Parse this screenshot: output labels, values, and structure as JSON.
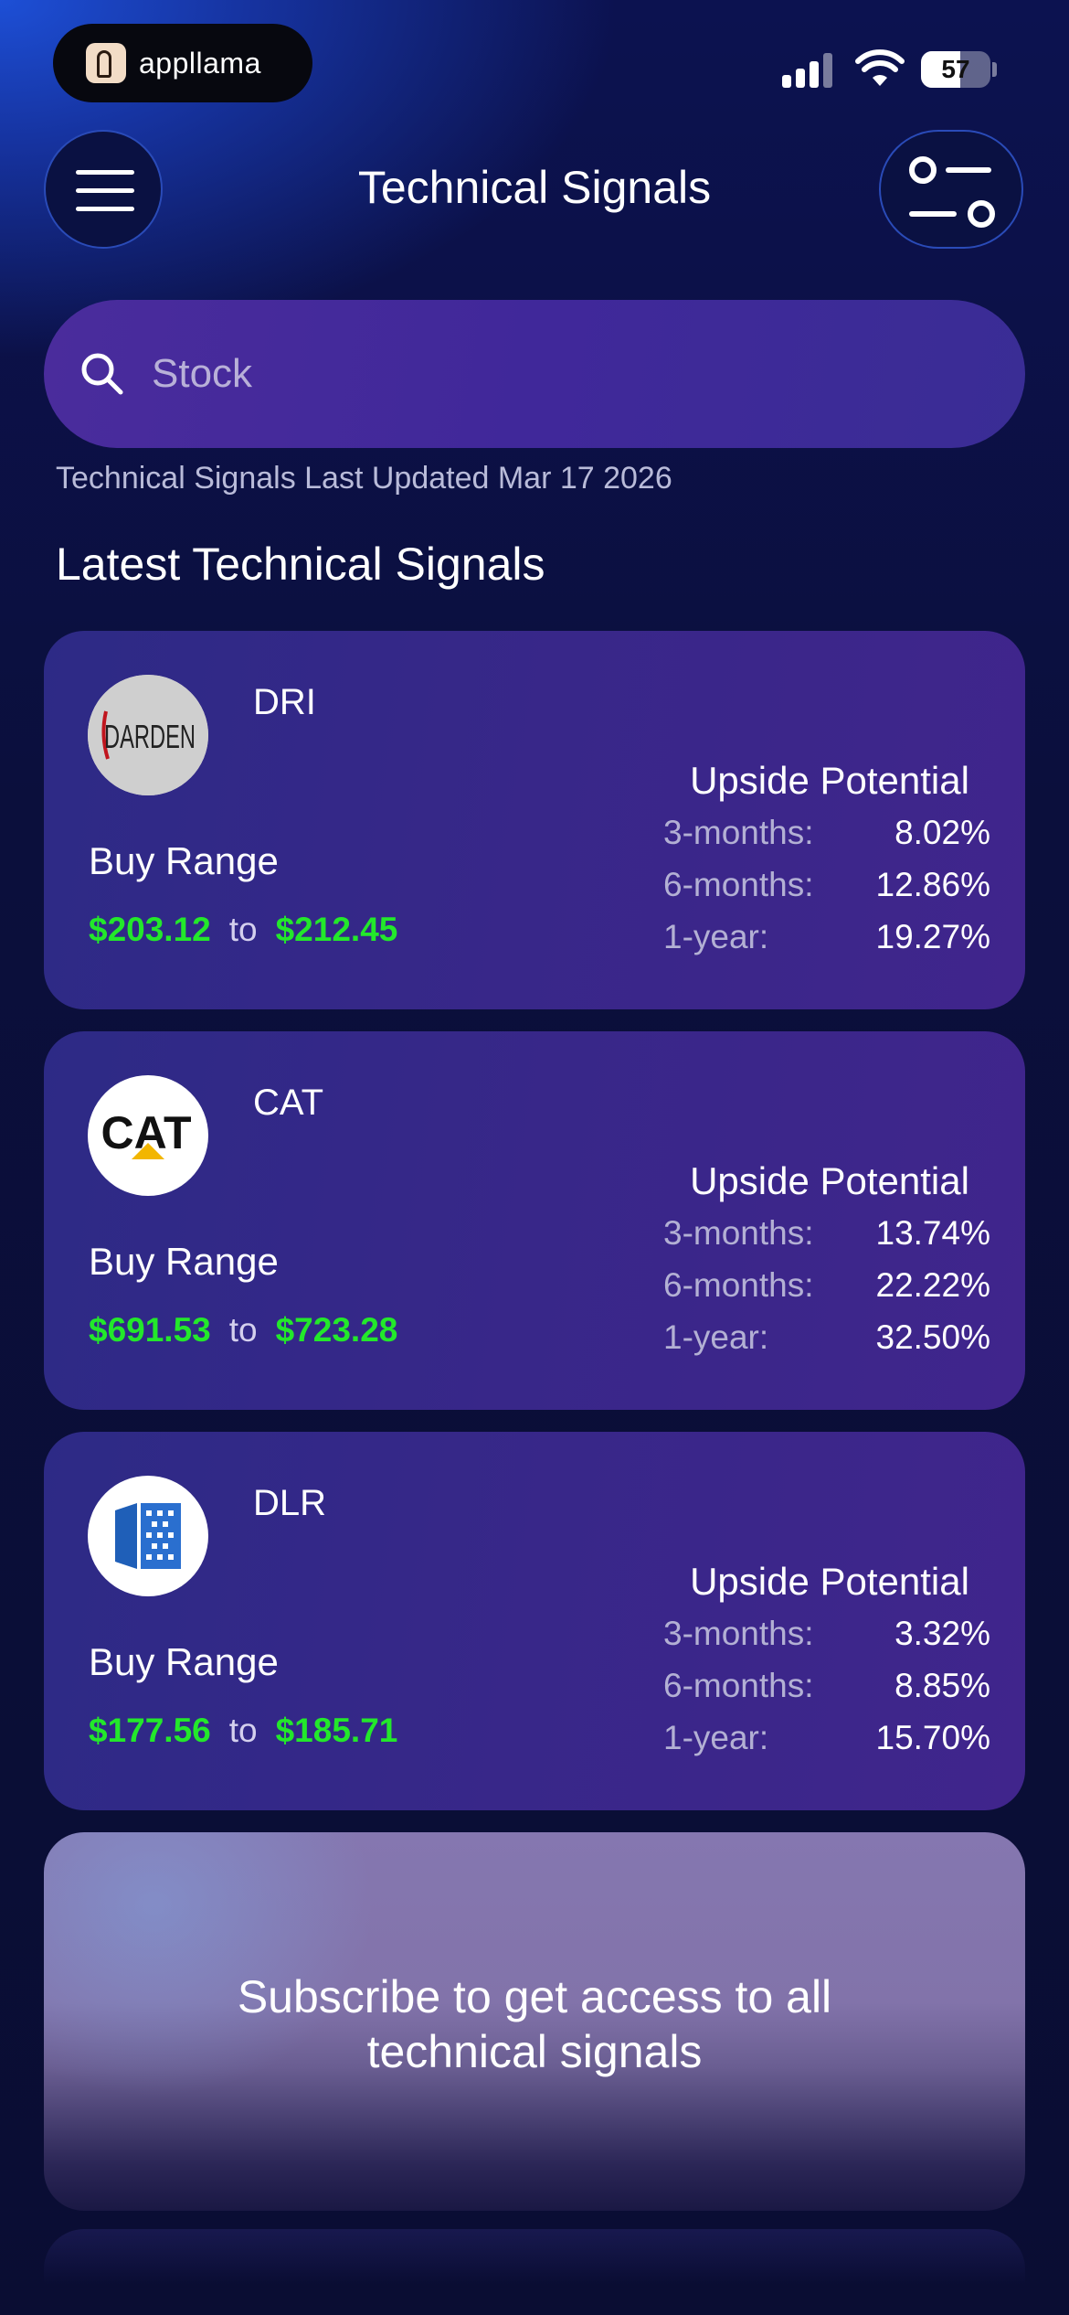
{
  "status_bar": {
    "app_badge": "appllama",
    "battery": "57"
  },
  "header": {
    "title": "Technical Signals"
  },
  "search": {
    "placeholder": "Stock"
  },
  "last_updated": "Technical Signals Last Updated Mar 17 2026",
  "section_title": "Latest Technical Signals",
  "labels": {
    "buy_range": "Buy Range",
    "to": "to",
    "upside": "Upside Potential",
    "three_months": "3-months:",
    "six_months": "6-months:",
    "one_year": "1-year:"
  },
  "signals": [
    {
      "ticker": "DRI",
      "logo": "darden-logo",
      "buy_low": "$203.12",
      "buy_high": "$212.45",
      "upside_3m": "8.02%",
      "upside_6m": "12.86%",
      "upside_1y": "19.27%"
    },
    {
      "ticker": "CAT",
      "logo": "caterpillar-logo",
      "logo_text": "CAT",
      "buy_low": "$691.53",
      "buy_high": "$723.28",
      "upside_3m": "13.74%",
      "upside_6m": "22.22%",
      "upside_1y": "32.50%"
    },
    {
      "ticker": "DLR",
      "logo": "digital-realty-logo",
      "buy_low": "$177.56",
      "buy_high": "$185.71",
      "upside_3m": "3.32%",
      "upside_6m": "8.85%",
      "upside_1y": "15.70%"
    }
  ],
  "subscribe": {
    "message_line1": "Subscribe to get access to all",
    "message_line2": "technical signals"
  },
  "colors": {
    "price_green": "#23e82b",
    "card_bg": "#382789",
    "page_bg": "#0b0f3a"
  }
}
